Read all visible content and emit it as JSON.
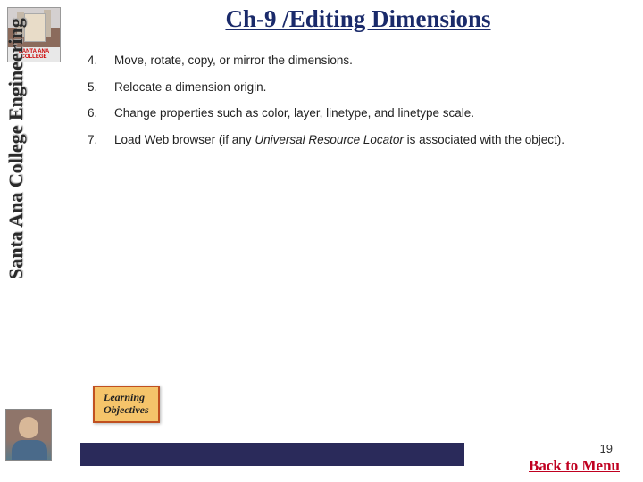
{
  "sidebar": {
    "logo_caption": "SANTA ANA COLLEGE",
    "vertical_text": "Santa Ana College Engineering"
  },
  "title": "Ch-9 /Editing Dimensions",
  "items": [
    {
      "num": "4.",
      "text": "Move, rotate, copy, or mirror the dimensions."
    },
    {
      "num": "5.",
      "text": "Relocate a dimension origin."
    },
    {
      "num": "6.",
      "text": "Change properties such as color, layer, linetype, and linetype scale."
    },
    {
      "num": "7.",
      "text_pre": "Load Web browser (if any ",
      "text_em": "Universal Resource Locator",
      "text_post": " is associated with the object)."
    }
  ],
  "learning_box": {
    "line1": "Learning",
    "line2": "Objectives"
  },
  "page_number": "19",
  "back_link": "Back to Menu"
}
